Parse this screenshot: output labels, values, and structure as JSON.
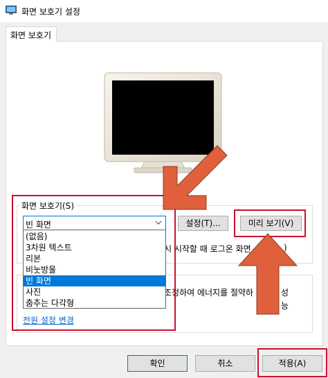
{
  "window": {
    "title": "화면 보호기 설정"
  },
  "tab": {
    "label": "화면 보호기"
  },
  "screensaver": {
    "group_label": "화면 보호기(S)",
    "selected": "빈 화면",
    "settings_button": "설정(T)...",
    "preview_button": "미리 보기(V)",
    "options": [
      "(없음)",
      "3차원 텍스트",
      "리본",
      "비눗방울",
      "빈 화면",
      "사진",
      "춤추는 다각형"
    ],
    "resume_text_partial": "시 시작할 때 로그온 화면",
    "resume_text_tail": ")"
  },
  "power": {
    "text_partial": "조정하여 에너지를 절약하",
    "text_tail_1": "성",
    "text_tail_2": "능",
    "link": "전원 설정 변경"
  },
  "footer": {
    "ok": "확인",
    "cancel": "취소",
    "apply": "적용(A)"
  },
  "colors": {
    "accent": "#0078d7",
    "highlight_red": "#c8102e",
    "arrow_orange": "#e0603c"
  }
}
